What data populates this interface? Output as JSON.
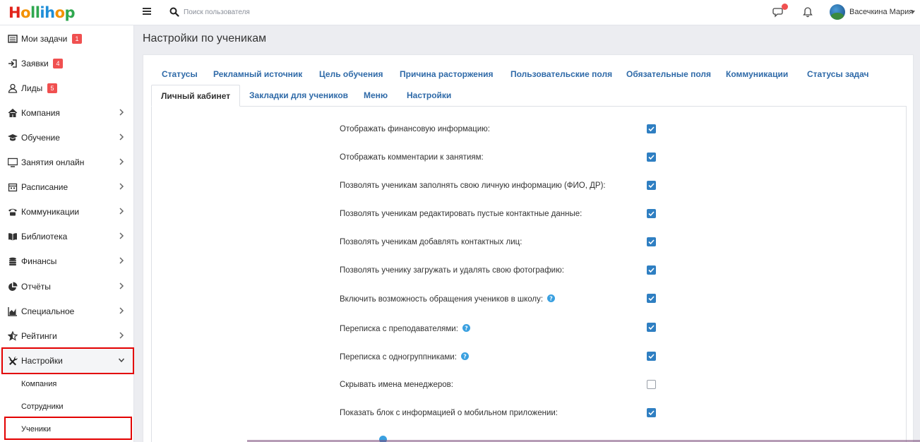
{
  "header": {
    "logo_parts": [
      "H",
      "o",
      "ll",
      "ih",
      "o",
      "p"
    ],
    "search_placeholder": "Поиск пользователя",
    "username": "Васечкина Мария",
    "icons": [
      "menu-icon",
      "search-icon",
      "chat-icon",
      "bell-icon",
      "avatar"
    ]
  },
  "sidebar": {
    "items": [
      {
        "label": "Мои задачи",
        "icon": "tasks-icon",
        "badge": "1"
      },
      {
        "label": "Заявки",
        "icon": "sign-in-icon",
        "badge": "4"
      },
      {
        "label": "Лиды",
        "icon": "user-icon",
        "badge": "5"
      },
      {
        "label": "Компания",
        "icon": "home-icon"
      },
      {
        "label": "Обучение",
        "icon": "graduation-cap-icon"
      },
      {
        "label": "Занятия онлайн",
        "icon": "monitor-icon"
      },
      {
        "label": "Расписание",
        "icon": "calendar-icon"
      },
      {
        "label": "Коммуникации",
        "icon": "phone-icon"
      },
      {
        "label": "Библиотека",
        "icon": "book-icon"
      },
      {
        "label": "Финансы",
        "icon": "coins-icon"
      },
      {
        "label": "Отчёты",
        "icon": "pie-chart-icon"
      },
      {
        "label": "Специальное",
        "icon": "area-chart-icon"
      },
      {
        "label": "Рейтинги",
        "icon": "star-icon"
      },
      {
        "label": "Настройки",
        "icon": "tools-icon",
        "expanded": true
      }
    ],
    "subitems": [
      {
        "label": "Компания"
      },
      {
        "label": "Сотрудники"
      },
      {
        "label": "Ученики",
        "selected": true
      }
    ]
  },
  "main": {
    "title": "Настройки по ученикам",
    "tabs_row1": [
      "Статусы",
      "Рекламный источник",
      "Цель обучения",
      "Причина расторжения",
      "Пользовательские поля",
      "Обязательные поля",
      "Коммуникации",
      "Статусы задач"
    ],
    "tabs_row2": [
      "Личный кабинет",
      "Закладки для учеников",
      "Меню",
      "Настройки"
    ],
    "active_tab": "Личный кабинет",
    "settings": [
      {
        "label": "Отображать финансовую информацию:",
        "checked": true,
        "info": false
      },
      {
        "label": "Отображать комментарии к занятиям:",
        "checked": true,
        "info": false
      },
      {
        "label": "Позволять ученикам заполнять свою личную информацию (ФИО, ДР):",
        "checked": true,
        "info": false
      },
      {
        "label": "Позволять ученикам редактировать пустые контактные данные:",
        "checked": true,
        "info": false
      },
      {
        "label": "Позволять ученикам добавлять контактных лиц:",
        "checked": true,
        "info": false
      },
      {
        "label": "Позволять ученику загружать и удалять свою фотографию:",
        "checked": true,
        "info": false
      },
      {
        "label": "Включить возможность обращения учеников в школу:",
        "checked": true,
        "info": true
      },
      {
        "label": "Переписка с преподавателями:",
        "checked": true,
        "info": true
      },
      {
        "label": "Переписка с одногруппниками:",
        "checked": true,
        "info": true
      },
      {
        "label": "Скрывать имена менеджеров:",
        "checked": false,
        "info": false
      },
      {
        "label": "Показать блок с информацией о мобильном приложении:",
        "checked": true,
        "info": false
      }
    ],
    "colors": {
      "accent": "#2f7fc2",
      "link": "#2f6aa8",
      "badge": "#f05050",
      "highlight": "#e30000"
    }
  }
}
